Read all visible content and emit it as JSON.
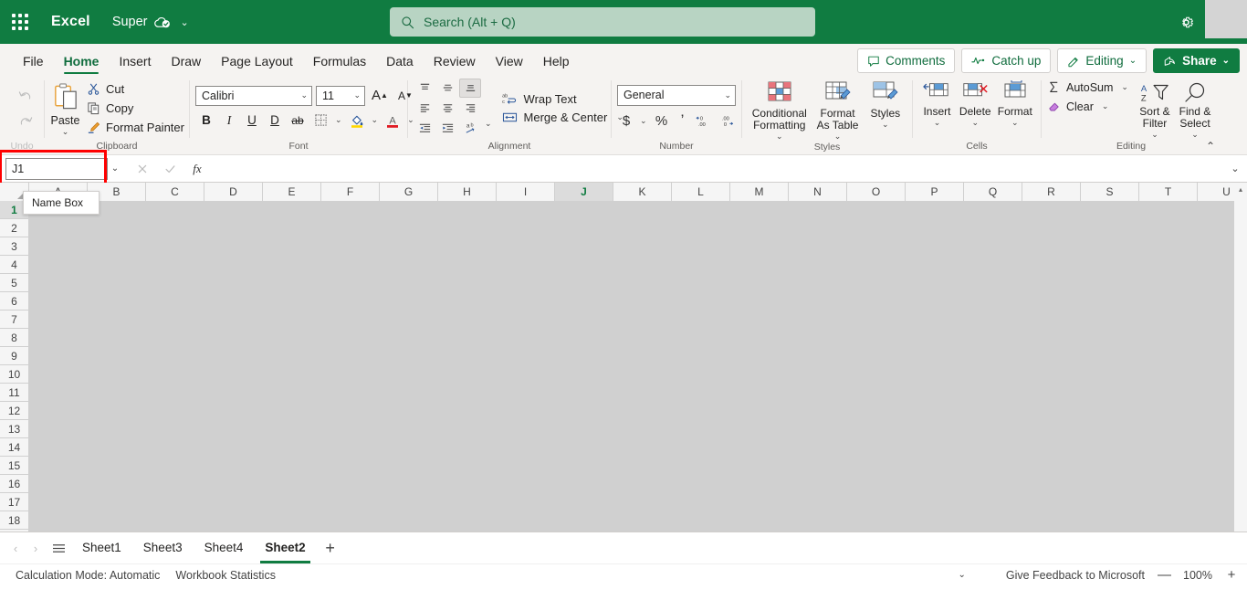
{
  "titlebar": {
    "app_name": "Excel",
    "document_name": "Super",
    "saved_icon": "cloud-check-icon",
    "chevron": "⌄",
    "search_placeholder": "Search (Alt + Q)",
    "search_value": "",
    "search_icon": "search-icon",
    "settings_icon": "gear-icon",
    "brand_color": "#107c41"
  },
  "ribbon_tabs": {
    "items": [
      {
        "label": "File",
        "active": false
      },
      {
        "label": "Home",
        "active": true
      },
      {
        "label": "Insert",
        "active": false
      },
      {
        "label": "Draw",
        "active": false
      },
      {
        "label": "Page Layout",
        "active": false
      },
      {
        "label": "Formulas",
        "active": false
      },
      {
        "label": "Data",
        "active": false
      },
      {
        "label": "Review",
        "active": false
      },
      {
        "label": "View",
        "active": false
      },
      {
        "label": "Help",
        "active": false
      }
    ],
    "right_buttons": {
      "comments": "Comments",
      "catch_up": "Catch up",
      "editing": "Editing",
      "editing_chevron": "⌄",
      "share": "Share",
      "share_chevron": "⌄"
    }
  },
  "ribbon": {
    "undo": {
      "group_label": "Undo",
      "undo_icon": "undo-icon",
      "redo_icon": "redo-icon"
    },
    "clipboard": {
      "group_label": "Clipboard",
      "paste_label": "Paste",
      "paste_chevron": "⌄",
      "cut_label": "Cut",
      "copy_label": "Copy",
      "format_painter_label": "Format Painter"
    },
    "font": {
      "group_label": "Font",
      "font_family": "Calibri",
      "font_size": "11",
      "grow_font": "A",
      "shrink_font": "A",
      "bold": "B",
      "italic": "I",
      "underline": "U",
      "double_underline": "D",
      "strikethrough": "ab",
      "borders_icon": "borders-icon",
      "fill_color_icon": "fill-color-icon",
      "font_color_icon": "font-color-icon",
      "chevron": "⌄"
    },
    "alignment": {
      "group_label": "Alignment",
      "wrap_text_label": "Wrap Text",
      "merge_center_label": "Merge & Center",
      "merge_chevron": "⌄",
      "orientation_chevron": "⌄"
    },
    "number": {
      "group_label": "Number",
      "format_value": "General",
      "currency_icon": "currency-icon",
      "currency_chevron": "⌄",
      "percent_icon": "%",
      "comma_icon": "comma-icon",
      "increase_decimal_icon": "increase-decimal-icon",
      "decrease_decimal_icon": "decrease-decimal-icon"
    },
    "styles": {
      "group_label": "Styles",
      "conditional_formatting": "Conditional Formatting",
      "format_as_table": "Format As Table",
      "styles": "Styles",
      "chevron": "⌄"
    },
    "cells": {
      "group_label": "Cells",
      "insert": "Insert",
      "delete": "Delete",
      "format": "Format",
      "chevron": "⌄"
    },
    "editing": {
      "group_label": "Editing",
      "autosum": "AutoSum",
      "autosum_chevron": "⌄",
      "clear": "Clear",
      "clear_chevron": "⌄",
      "sort_filter": "Sort & Filter",
      "sort_filter_chevron": "⌄",
      "find_select": "Find & Select",
      "find_select_chevron": "⌄",
      "collapse_icon": "⌃"
    }
  },
  "formula_bar": {
    "name_box_value": "J1",
    "name_box_chevron": "⌄",
    "cancel_icon": "cancel-icon",
    "confirm_icon": "confirm-icon",
    "function_icon": "fx",
    "formula_value": "",
    "expand_chevron": "⌄",
    "highlight_color": "#ff0000"
  },
  "tooltip": {
    "text": "Name Box"
  },
  "grid": {
    "columns": [
      "A",
      "B",
      "C",
      "D",
      "E",
      "F",
      "G",
      "H",
      "I",
      "J",
      "K",
      "L",
      "M",
      "N",
      "O",
      "P",
      "Q",
      "R",
      "S",
      "T",
      "U"
    ],
    "active_column": "J",
    "rows": [
      "1",
      "2",
      "3",
      "4",
      "5",
      "6",
      "7",
      "8",
      "9",
      "10",
      "11",
      "12",
      "13",
      "14",
      "15",
      "16",
      "17",
      "18"
    ],
    "active_row": "1",
    "active_cell": "J1",
    "scroll_up_icon": "▴",
    "scroll_down_icon": "▾"
  },
  "sheet_tabs": {
    "prev_icon": "‹",
    "next_icon": "›",
    "all_sheets_icon": "hamburger-icon",
    "items": [
      {
        "label": "Sheet1",
        "active": false
      },
      {
        "label": "Sheet3",
        "active": false
      },
      {
        "label": "Sheet4",
        "active": false
      },
      {
        "label": "Sheet2",
        "active": true
      }
    ],
    "add_sheet_icon": "+"
  },
  "status_bar": {
    "calculation_mode": "Calculation Mode: Automatic",
    "workbook_statistics": "Workbook Statistics",
    "chevron": "⌄",
    "feedback": "Give Feedback to Microsoft",
    "zoom_out_icon": "—",
    "zoom_level": "100%",
    "zoom_in_icon": "+"
  }
}
